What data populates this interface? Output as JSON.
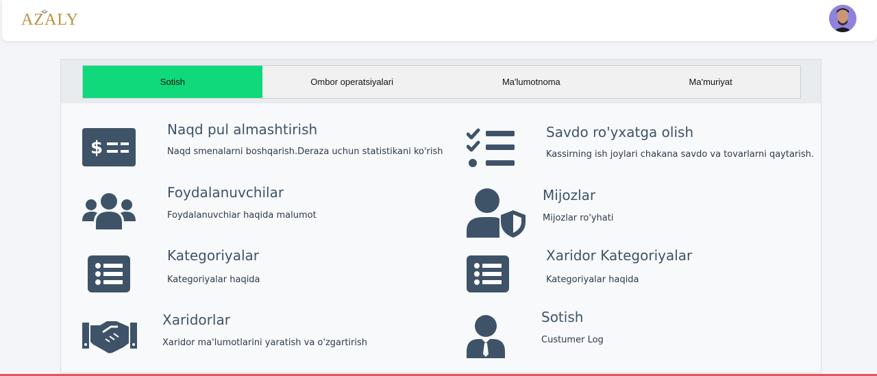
{
  "header": {
    "logo_text": "AZALY"
  },
  "tabs": [
    {
      "label": "Sotish",
      "active": true
    },
    {
      "label": "Ombor operatsiyalari",
      "active": false
    },
    {
      "label": "Ma'lumotnoma",
      "active": false
    },
    {
      "label": "Ma'muriyat",
      "active": false
    }
  ],
  "colors": {
    "accent": "#0fd97a",
    "icon": "#3e5368"
  },
  "cards": [
    {
      "title": "Naqd pul almashtirish",
      "desc": "Naqd smenalarni boshqarish.Deraza uchun statistikani ko'rish",
      "icon": "cash-icon"
    },
    {
      "title": "Savdo ro'yxatga olish",
      "desc": "Kassirning ish joylari chakana savdo va tovarlarni qaytarish.",
      "icon": "checklist-icon"
    },
    {
      "title": "Foydalanuvchilar",
      "desc": "Foydalanuvchiar haqida malumot",
      "icon": "users-icon"
    },
    {
      "title": "Mijozlar",
      "desc": "Mijozlar ro'yhati",
      "icon": "user-shield-icon"
    },
    {
      "title": "Kategoriyalar",
      "desc": "Kategoriyalar haqida",
      "icon": "list-icon"
    },
    {
      "title": "Xaridor Kategoriyalar",
      "desc": "Kategoriyalar haqida",
      "icon": "list-icon"
    },
    {
      "title": "Xaridorlar",
      "desc": "Xaridor ma'lumotlarini yaratish va o'zgartirish",
      "icon": "handshake-icon"
    },
    {
      "title": "Sotish",
      "desc": "Custumer Log",
      "icon": "user-tie-icon"
    }
  ]
}
